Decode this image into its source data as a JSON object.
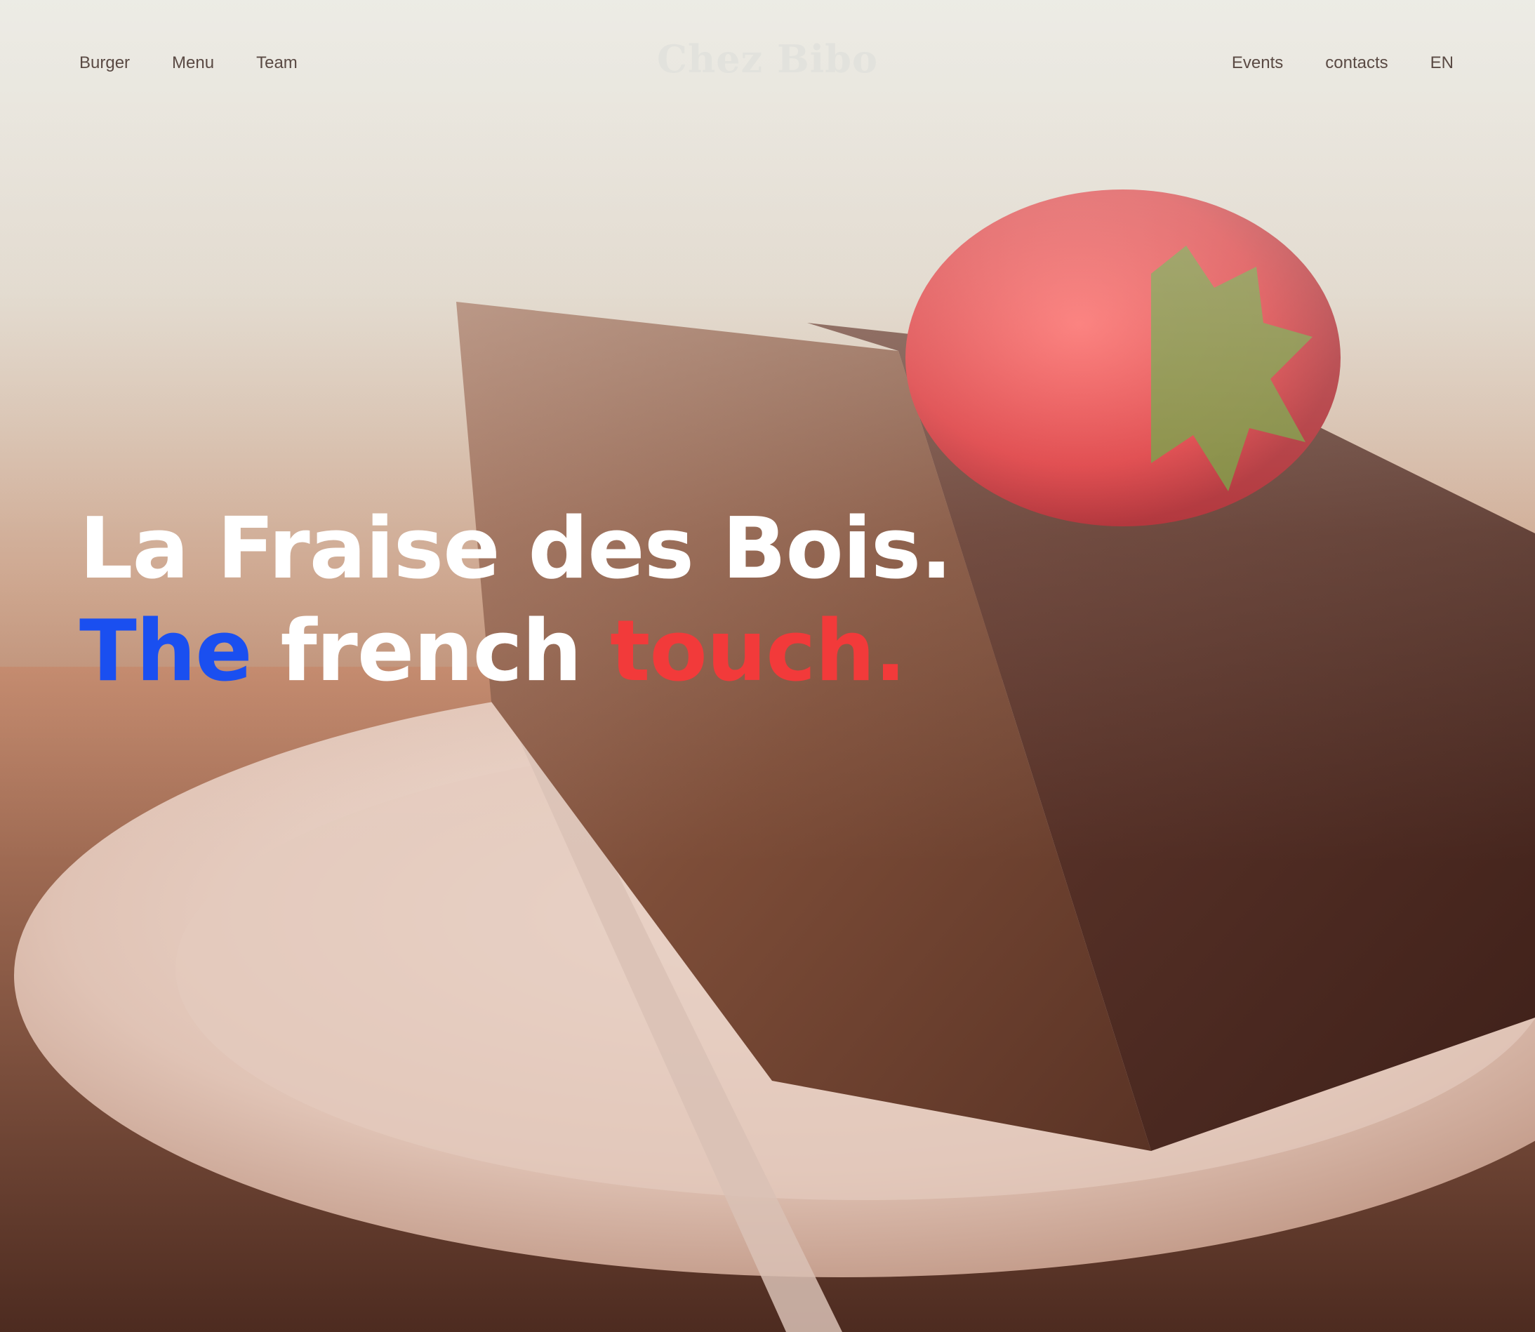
{
  "nav": {
    "left": [
      {
        "label": "Burger"
      },
      {
        "label": "Menu"
      },
      {
        "label": "Team"
      }
    ],
    "right": [
      {
        "label": "Events"
      },
      {
        "label": "contacts"
      },
      {
        "label": "EN"
      }
    ]
  },
  "brand": {
    "logo_text": "Chez Bibo"
  },
  "hero": {
    "line1": "La Fraise des Bois.",
    "line2": {
      "word1": "The",
      "word2": "french",
      "word3": "touch."
    }
  },
  "colors": {
    "accent_blue": "#1a4ff0",
    "accent_red": "#f23a3a",
    "headline_white": "#ffffff",
    "nav_text": "#5a4a44"
  },
  "background": {
    "image": "chocolate-cake-with-strawberry-on-plate"
  }
}
